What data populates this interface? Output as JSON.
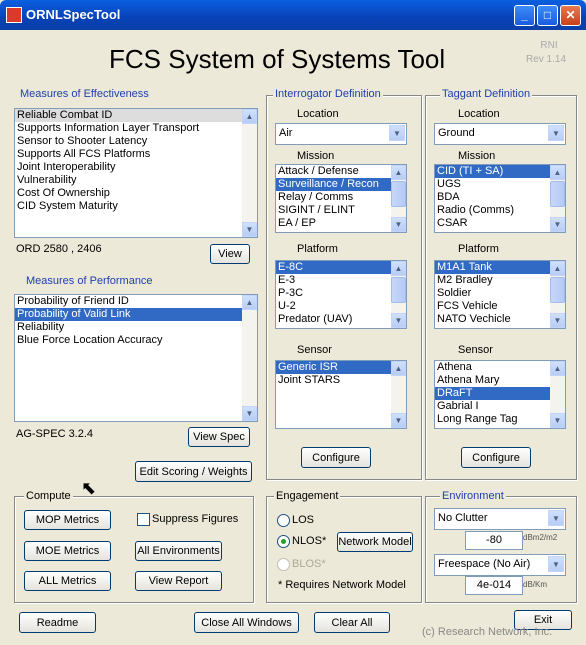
{
  "window": {
    "title": "ORNLSpecTool",
    "minimize": "_",
    "maximize": "□",
    "close": "✕"
  },
  "app": {
    "heading": "FCS System of Systems Tool",
    "version_line1": "RNI",
    "version_line2": "Rev 1.14",
    "copyright": "(c) Research Network, Inc."
  },
  "moe": {
    "label": "Measures of Effectiveness",
    "items": [
      "Reliable Combat ID",
      "Supports Information Layer Transport",
      "Sensor to Shooter Latency",
      "Supports All FCS Platforms",
      "Joint Interoperability",
      "Vulnerability",
      "Cost Of Ownership",
      "CID System Maturity"
    ],
    "ord_text": "ORD 2580 , 2406",
    "view_button": "View"
  },
  "mop": {
    "label": "Measures of Performance",
    "items": [
      "Probability of Friend ID",
      "Probability of Valid Link",
      "Reliability",
      "Blue Force Location Accuracy"
    ],
    "spec_text": "AG-SPEC 3.2.4",
    "view_spec_button": "View Spec",
    "edit_button": "Edit Scoring / Weights"
  },
  "interrogator": {
    "label": "Interrogator Definition",
    "location_label": "Location",
    "location_value": "Air",
    "mission_label": "Mission",
    "missions": [
      "Attack / Defense",
      "Surveillance / Recon",
      "Relay / Comms",
      "SIGINT / ELINT",
      "EA / EP"
    ],
    "platform_label": "Platform",
    "platforms": [
      "E-8C",
      "E-3",
      "P-3C",
      "U-2",
      "Predator (UAV)"
    ],
    "sensor_label": "Sensor",
    "sensors": [
      "Generic ISR",
      "Joint STARS"
    ],
    "configure_button": "Configure"
  },
  "taggant": {
    "label": "Taggant Definition",
    "location_label": "Location",
    "location_value": "Ground",
    "mission_label": "Mission",
    "missions": [
      "CID (TI + SA)",
      "UGS",
      "BDA",
      "Radio (Comms)",
      "CSAR"
    ],
    "platform_label": "Platform",
    "platforms": [
      "M1A1 Tank",
      "M2  Bradley",
      "Soldier",
      "FCS Vehicle",
      "NATO Vechicle"
    ],
    "sensor_label": "Sensor",
    "sensors": [
      "Athena",
      "Athena Mary",
      "DRaFT",
      "Gabrial I",
      "Long Range Tag"
    ],
    "configure_button": "Configure"
  },
  "compute": {
    "label": "Compute",
    "mop_metrics": "MOP Metrics",
    "suppress_figures": "Suppress Figures",
    "moe_metrics": "MOE Metrics",
    "all_environments": "All Environments",
    "all_metrics": "ALL Metrics",
    "view_report": "View Report"
  },
  "engagement": {
    "label": "Engagement",
    "los": "LOS",
    "nlos": "NLOS*",
    "blos": "BLOS*",
    "network_model": "Network Model",
    "note": "* Requires Network Model"
  },
  "environment": {
    "label": "Environment",
    "clutter_value": "No Clutter",
    "clutter_level": "-80",
    "clutter_unit": "dBm2/m2",
    "propagation_value": "Freespace (No Air)",
    "propagation_level": "4e-014",
    "propagation_unit": "dB/Km"
  },
  "footer": {
    "readme": "Readme",
    "close_all_windows": "Close All Windows",
    "clear_all": "Clear All",
    "exit": "Exit"
  }
}
